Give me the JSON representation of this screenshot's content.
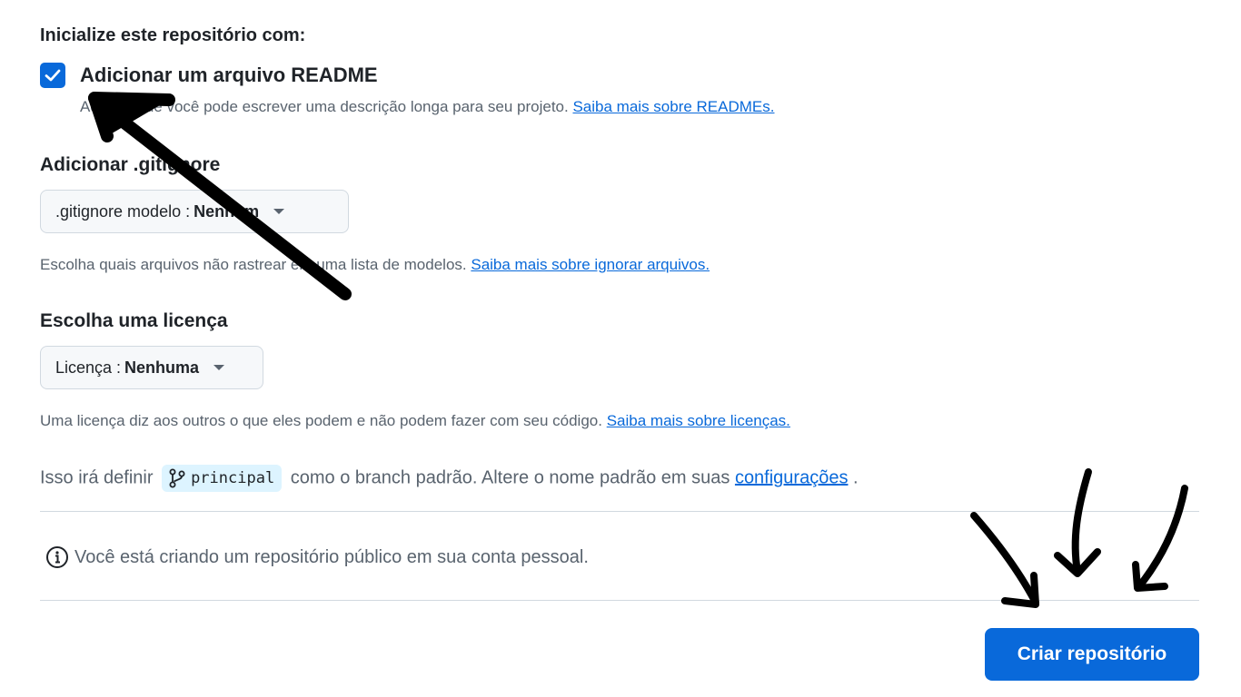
{
  "init": {
    "heading": "Inicialize este repositório com:",
    "readme_label": "Adicionar um arquivo README",
    "readme_desc_prefix": "Aqui é onde você pode escrever uma descrição longa para seu projeto.",
    "readme_link": "Saiba mais sobre READMEs.",
    "readme_checked": true
  },
  "gitignore": {
    "heading": "Adicionar .gitignore",
    "dropdown_prefix": ".gitignore modelo :",
    "dropdown_value": "Nenhum",
    "desc_prefix": "Escolha quais arquivos não rastrear em uma lista de modelos.",
    "link": "Saiba mais sobre ignorar arquivos."
  },
  "license": {
    "heading": "Escolha uma licença",
    "dropdown_prefix": "Licença :",
    "dropdown_value": "Nenhuma",
    "desc_prefix": "Uma licença diz aos outros o que eles podem e não podem fazer com seu código.",
    "link": "Saiba mais sobre licenças."
  },
  "branch": {
    "text_before": "Isso irá definir",
    "branch_name": "principal",
    "text_after": "como o branch padrão. Altere o nome padrão em suas",
    "link": "configurações",
    "text_end": "."
  },
  "notice": {
    "text": "Você está criando um repositório público em sua conta pessoal."
  },
  "submit": {
    "label": "Criar repositório"
  },
  "colors": {
    "accent": "#0969da",
    "pill_bg": "#ddf4ff",
    "muted_text": "#59636e",
    "annotation": "#000000"
  },
  "icons": [
    "check-icon",
    "caret-down-icon",
    "git-branch-icon",
    "info-icon"
  ]
}
